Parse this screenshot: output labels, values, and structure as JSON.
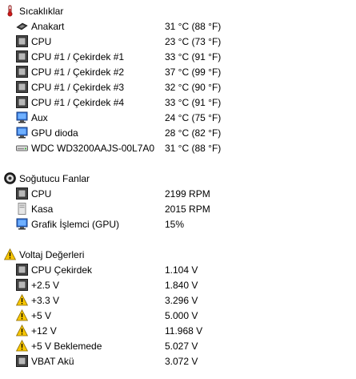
{
  "sections": [
    {
      "title": "Sıcaklıklar",
      "icon": "thermometer-icon",
      "items": [
        {
          "label": "Anakart",
          "value": "31 °C  (88 °F)",
          "icon": "motherboard-icon"
        },
        {
          "label": "CPU",
          "value": "23 °C  (73 °F)",
          "icon": "cpu-chip-icon"
        },
        {
          "label": "CPU #1 / Çekirdek #1",
          "value": "33 °C  (91 °F)",
          "icon": "cpu-chip-icon"
        },
        {
          "label": "CPU #1 / Çekirdek #2",
          "value": "37 °C  (99 °F)",
          "icon": "cpu-chip-icon"
        },
        {
          "label": "CPU #1 / Çekirdek #3",
          "value": "32 °C  (90 °F)",
          "icon": "cpu-chip-icon"
        },
        {
          "label": "CPU #1 / Çekirdek #4",
          "value": "33 °C  (91 °F)",
          "icon": "cpu-chip-icon"
        },
        {
          "label": "Aux",
          "value": "24 °C  (75 °F)",
          "icon": "monitor-icon"
        },
        {
          "label": "GPU dioda",
          "value": "28 °C  (82 °F)",
          "icon": "monitor-icon"
        },
        {
          "label": "WDC WD3200AAJS-00L7A0",
          "value": "31 °C  (88 °F)",
          "icon": "hard-drive-icon"
        }
      ]
    },
    {
      "title": "Soğutucu Fanlar",
      "icon": "fan-icon",
      "items": [
        {
          "label": "CPU",
          "value": "2199 RPM",
          "icon": "cpu-chip-icon"
        },
        {
          "label": "Kasa",
          "value": "2015 RPM",
          "icon": "case-icon"
        },
        {
          "label": "Grafik İşlemci (GPU)",
          "value": "15%",
          "icon": "monitor-icon"
        }
      ]
    },
    {
      "title": "Voltaj Değerleri",
      "icon": "warning-icon",
      "items": [
        {
          "label": "CPU Çekirdek",
          "value": "1.104 V",
          "icon": "cpu-chip-icon"
        },
        {
          "label": "+2.5 V",
          "value": "1.840 V",
          "icon": "cpu-chip-icon"
        },
        {
          "label": "+3.3 V",
          "value": "3.296 V",
          "icon": "warning-icon"
        },
        {
          "label": "+5 V",
          "value": "5.000 V",
          "icon": "warning-icon"
        },
        {
          "label": "+12 V",
          "value": "11.968 V",
          "icon": "warning-icon"
        },
        {
          "label": "+5 V Beklemede",
          "value": "5.027 V",
          "icon": "warning-icon"
        },
        {
          "label": "VBAT Akü",
          "value": "3.072 V",
          "icon": "cpu-chip-icon"
        }
      ]
    }
  ]
}
